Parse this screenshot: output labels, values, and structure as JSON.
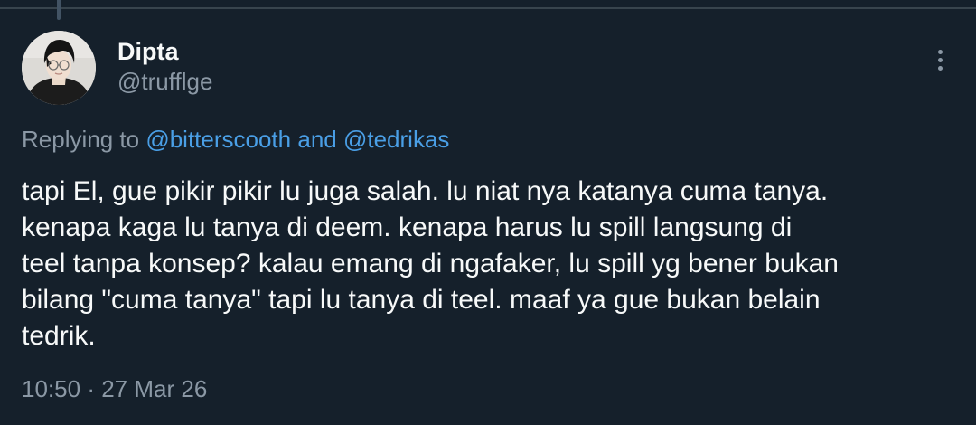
{
  "author": {
    "display_name": "Dipta",
    "handle": "@trufflge",
    "avatar_icon": "profile-photo"
  },
  "reply_context": {
    "prefix": "Replying to",
    "mention_1": "@bitterscooth",
    "conjunction": "and",
    "mention_2": "@tedrikas"
  },
  "tweet": {
    "lines": [
      "tapi El, gue pikir pikir lu juga salah. lu niat nya katanya cuma tanya.",
      "kenapa kaga lu tanya di deem. kenapa harus lu spill langsung di",
      "teel tanpa konsep? kalau emang di ngafaker, lu spill yg bener bukan",
      "bilang \"cuma tanya\" tapi lu tanya di teel. maaf ya gue bukan belain",
      "tedrik."
    ]
  },
  "meta": {
    "time": "10:50",
    "separator": "·",
    "date": "27 Mar 26"
  },
  "icons": {
    "more": "more-vertical-icon"
  },
  "colors": {
    "background": "#15202b",
    "text": "#f7f9f9",
    "secondary_text": "#8b98a5",
    "link": "#4a9fe6",
    "divider": "#38444d"
  }
}
